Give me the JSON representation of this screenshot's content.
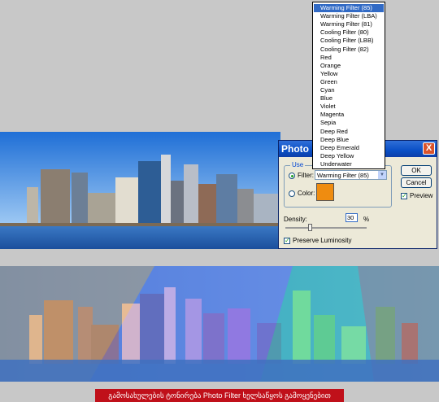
{
  "dialog": {
    "title": "Photo Filter",
    "close_glyph": "X",
    "use_group_label": "Use",
    "filter_label": "Filter:",
    "filter_value": "Warming Filter (85)",
    "color_label": "Color:",
    "filter_color": "#ef8c10",
    "ok_label": "OK",
    "cancel_label": "Cancel",
    "preview_label": "Preview",
    "density_label": "Density:",
    "density_value": "30",
    "density_unit": "%",
    "density_level_percent": 30,
    "preserve_label": "Preserve Luminosity"
  },
  "dropdown": {
    "options": [
      "Warming Filter (85)",
      "Warming Filter (LBA)",
      "Warming Filter (81)",
      "Cooling Filter (80)",
      "Cooling Filter (LBB)",
      "Cooling Filter (82)",
      "Red",
      "Orange",
      "Yellow",
      "Green",
      "Cyan",
      "Blue",
      "Violet",
      "Magenta",
      "Sepia",
      "Deep Red",
      "Deep Blue",
      "Deep Emerald",
      "Deep Yellow",
      "Underwater"
    ],
    "selected": "Warming Filter (85)"
  },
  "caption": "გამოსახულების ტონირება Photo Filter ხელსაწყოს გამოყენებით"
}
